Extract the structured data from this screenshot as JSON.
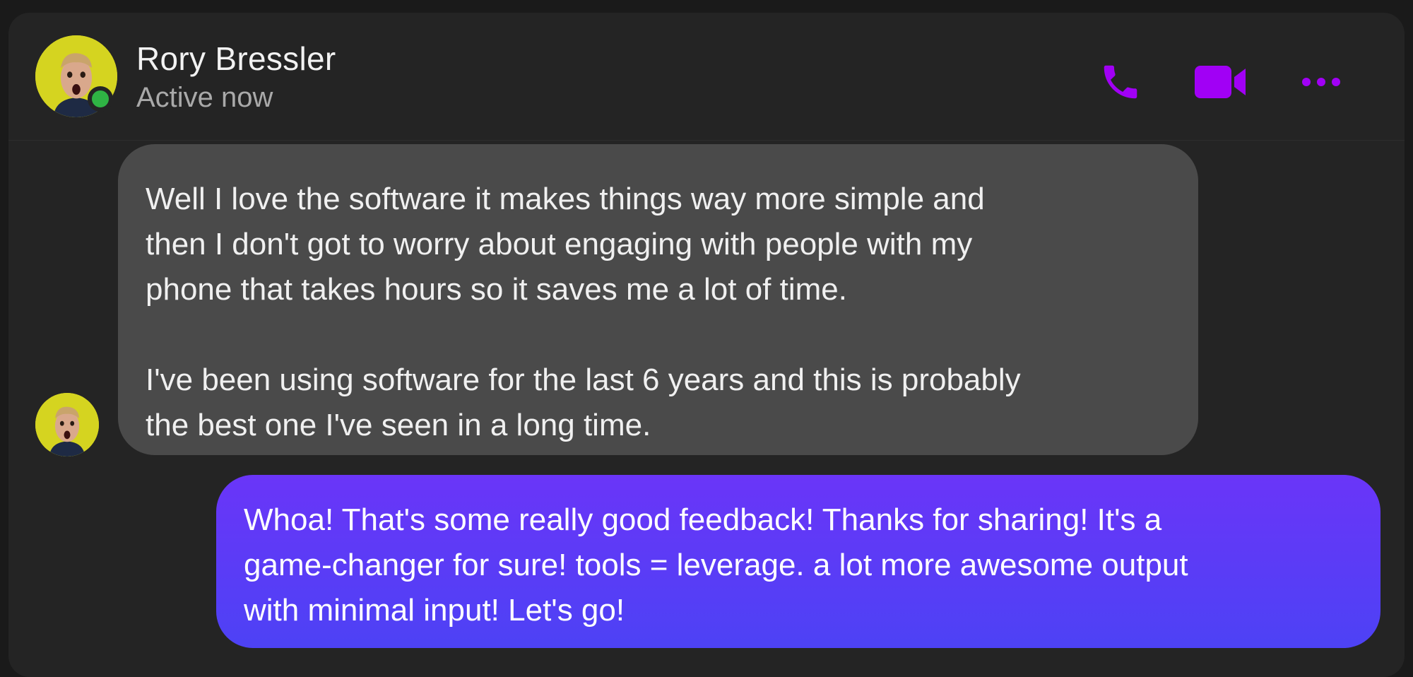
{
  "header": {
    "contact_name": "Rory Bressler",
    "contact_status": "Active now"
  },
  "icons": {
    "call": "phone-icon",
    "video": "video-camera-icon",
    "more": "more-dots-icon"
  },
  "colors": {
    "accent": "#a100f5",
    "online": "#2fb344",
    "incoming_bubble": "#4a4a4a",
    "outgoing_bubble_top": "#6a35f8",
    "outgoing_bubble_bottom": "#4d42f5"
  },
  "messages": [
    {
      "direction": "incoming",
      "text": "Well I love the software it makes things way more simple and\nthen I don't got to worry about engaging with people with my\nphone that takes hours so it saves me a lot of time.\n\nI've been using software for the last 6 years and this is probably\nthe best one I've seen in a long time."
    },
    {
      "direction": "outgoing",
      "text": "Whoa! That's some really good feedback! Thanks for sharing! It's a\ngame-changer for sure! tools = leverage. a lot more awesome output\nwith minimal input! Let's go!"
    }
  ]
}
